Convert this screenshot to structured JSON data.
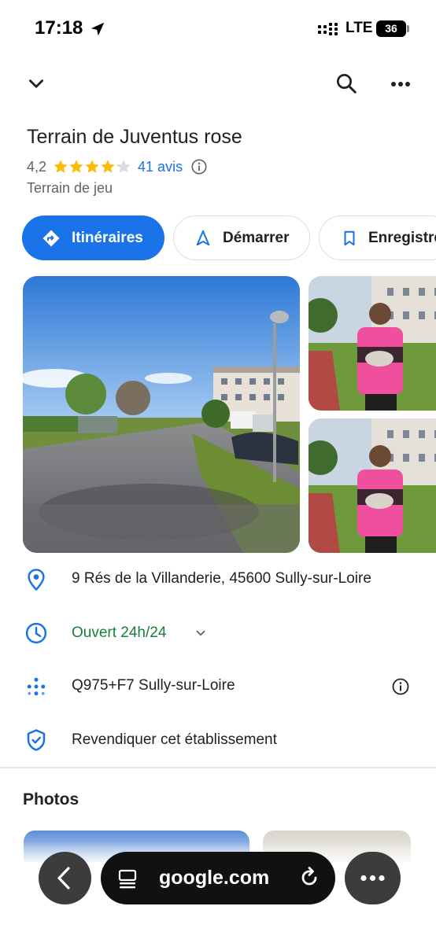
{
  "status_bar": {
    "time": "17:18",
    "network": "LTE",
    "battery": "36"
  },
  "top_bar": {
    "icons": [
      "chevron-down-icon",
      "search-icon",
      "more-icon"
    ]
  },
  "place": {
    "title": "Terrain de Juventus rose",
    "rating": "4,2",
    "rating_value": 4.2,
    "rating_max": 5,
    "reviews": "41 avis",
    "category": "Terrain de jeu"
  },
  "actions": {
    "directions": "Itinéraires",
    "start": "Démarrer",
    "save": "Enregistrer"
  },
  "info": {
    "address": "9 Rés de la Villanderie, 45600 Sully-sur-Loire",
    "hours": "Ouvert 24h/24",
    "plus_code": "Q975+F7 Sully-sur-Loire",
    "claim": "Revendiquer cet établissement"
  },
  "photos": {
    "heading": "Photos"
  },
  "browser": {
    "url": "google.com"
  },
  "colors": {
    "accent": "#1a73e8",
    "open_green": "#188038",
    "star": "#fbbc04"
  }
}
